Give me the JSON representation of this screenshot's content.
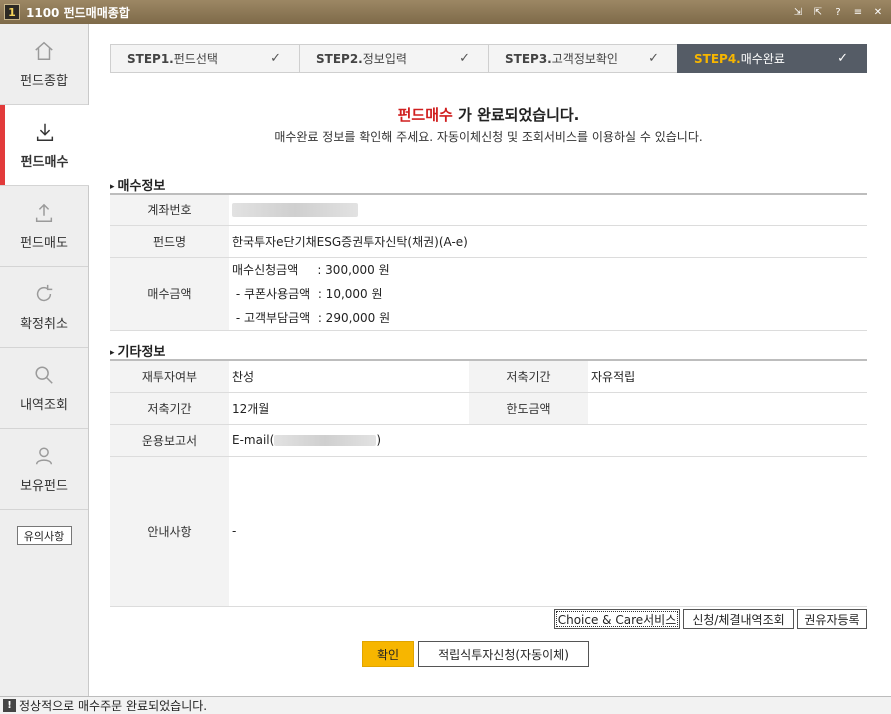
{
  "window": {
    "app_number": "1",
    "title": "1100 펀드매매종합",
    "controls": [
      "⇲",
      "⇱",
      "?",
      "≡",
      "✕"
    ]
  },
  "sidebar": {
    "items": [
      {
        "label": "펀드종합",
        "icon": "home-icon"
      },
      {
        "label": "펀드매수",
        "icon": "download-icon"
      },
      {
        "label": "펀드매도",
        "icon": "upload-icon"
      },
      {
        "label": "확정취소",
        "icon": "refresh-icon"
      },
      {
        "label": "내역조회",
        "icon": "search-icon"
      },
      {
        "label": "보유펀드",
        "icon": "user-icon"
      }
    ],
    "note_button": "유의사항"
  },
  "steps": [
    {
      "num": "STEP1.",
      "label": " 펀드선택",
      "check": "✓"
    },
    {
      "num": "STEP2.",
      "label": " 정보입력",
      "check": "✓"
    },
    {
      "num": "STEP3.",
      "label": " 고객정보확인",
      "check": "✓"
    },
    {
      "num": "STEP4.",
      "label": " 매수완료",
      "check": "✓"
    }
  ],
  "message": {
    "highlight": "펀드매수",
    "title_rest": " 가 완료되었습니다.",
    "subtitle": "매수완료 정보를 확인해 주세요. 자동이체신청 및 조회서비스를 이용하실 수 있습니다."
  },
  "purchase_info": {
    "title": "매수정보",
    "account_label": "계좌번호",
    "fund_label": "펀드명",
    "fund_value": "한국투자e단기채ESG증권투자신탁(채권)(A-e)",
    "amount_label": "매수금액",
    "amount_lines": [
      "매수신청금액     : 300,000 원",
      " - 쿠폰사용금액  : 10,000 원",
      " - 고객부담금액  : 290,000 원"
    ]
  },
  "other_info": {
    "title": "기타정보",
    "reinvest_label": "재투자여부",
    "reinvest_value": "찬성",
    "saving_type_label": "저축기간",
    "saving_type_value": "자유적립",
    "period_label": "저축기간",
    "period_value": "12개월",
    "limit_label": "한도금액",
    "limit_value": "",
    "report_label": "운용보고서",
    "report_prefix": "E-mail(",
    "report_suffix": ")",
    "notice_label": "안내사항",
    "notice_value": "-"
  },
  "actions": {
    "choice_care": "Choice & Care서비스",
    "history": "신청/체결내역조회",
    "solicitor": "권유자등록",
    "confirm": "확인",
    "auto_transfer": "적립식투자신청(자동이체)"
  },
  "status": {
    "icon": "!",
    "text": "정상적으로 매수주문 완료되었습니다."
  },
  "colors": {
    "accent_red": "#e23b3b",
    "highlight_red": "#d01f1f",
    "step_active_bg": "#555c66",
    "step_active_num": "#f7b600",
    "confirm_yellow": "#f7b600",
    "titlebar": "#8c7856"
  }
}
